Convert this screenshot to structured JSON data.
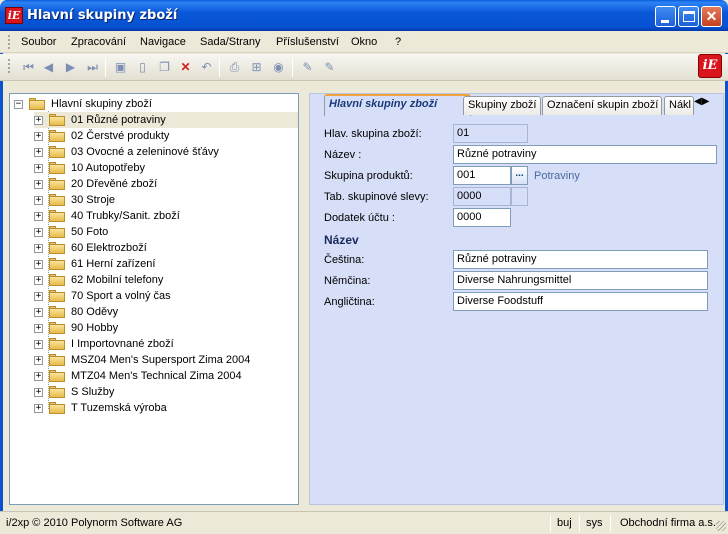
{
  "window": {
    "title": "Hlavní skupiny zboží",
    "logo_text": "iE"
  },
  "menu": [
    "Soubor",
    "Zpracování",
    "Navigace",
    "Sada/Strany",
    "Příslušenství",
    "Okno",
    "?"
  ],
  "toolbar": {
    "icons": [
      "first-record-icon",
      "previous-record-icon",
      "next-record-icon",
      "last-record-icon",
      "save-icon",
      "new-document-icon",
      "copy-icon",
      "delete-icon",
      "undo-icon",
      "print-icon",
      "tree-view-icon",
      "settings-icon",
      "edit-pen-icon",
      "edit-pen-disabled-icon"
    ]
  },
  "tree": {
    "root": "Hlavní skupiny zboží",
    "items": [
      {
        "label": "01  Různé potraviny",
        "selected": true
      },
      {
        "label": "02  Čerstvé produkty"
      },
      {
        "label": "03  Ovocné a zeleninové šťávy"
      },
      {
        "label": "10  Autopotřeby"
      },
      {
        "label": "20  Dřevěné zboží"
      },
      {
        "label": "30  Stroje"
      },
      {
        "label": "40  Trubky/Sanit. zboží"
      },
      {
        "label": "50  Foto"
      },
      {
        "label": "60  Elektrozboží"
      },
      {
        "label": "61  Herní zařízení"
      },
      {
        "label": "62  Mobilní telefony"
      },
      {
        "label": "70  Sport a volný čas"
      },
      {
        "label": "80  Oděvy"
      },
      {
        "label": "90  Hobby"
      },
      {
        "label": "I  Importovnané zboží"
      },
      {
        "label": "MSZ04  Men's Supersport Zima 2004"
      },
      {
        "label": "MTZ04  Men's Technical Zima 2004"
      },
      {
        "label": "S  Služby"
      },
      {
        "label": "T  Tuzemská výroba"
      }
    ]
  },
  "tabs": [
    "Hlavní skupiny zboží",
    "Skupiny zboží",
    "Označení skupin zboží",
    "Nákl"
  ],
  "form": {
    "main_group_label": "Hlav. skupina zboží:",
    "main_group_value": "01",
    "name_label": "Název     :",
    "name_value": "Různé potraviny",
    "product_group_label": "Skupina produktů:",
    "product_group_value": "001",
    "product_group_button": "...",
    "product_group_text": "Potraviny",
    "discount_label": "Tab. skupinové slevy:",
    "discount_value": "0000",
    "account_label": "Dodatek účtu  :",
    "account_value": "0000",
    "section_title": "Název",
    "czech_label": "Čeština:",
    "czech_value": "Různé potraviny",
    "german_label": "Němčina:",
    "german_value": "Diverse Nahrungsmittel",
    "english_label": "Angličtina:",
    "english_value": "Diverse Foodstuff"
  },
  "status": {
    "copyright": "i/2xp © 2010 Polynorm Software AG",
    "language": "buj",
    "user": "sys",
    "company": "Obchodní firma a.s."
  },
  "colors": {
    "titlebar": "#0a58d8",
    "panel_bg": "#d6dff7",
    "brand_red": "#d8141c"
  }
}
